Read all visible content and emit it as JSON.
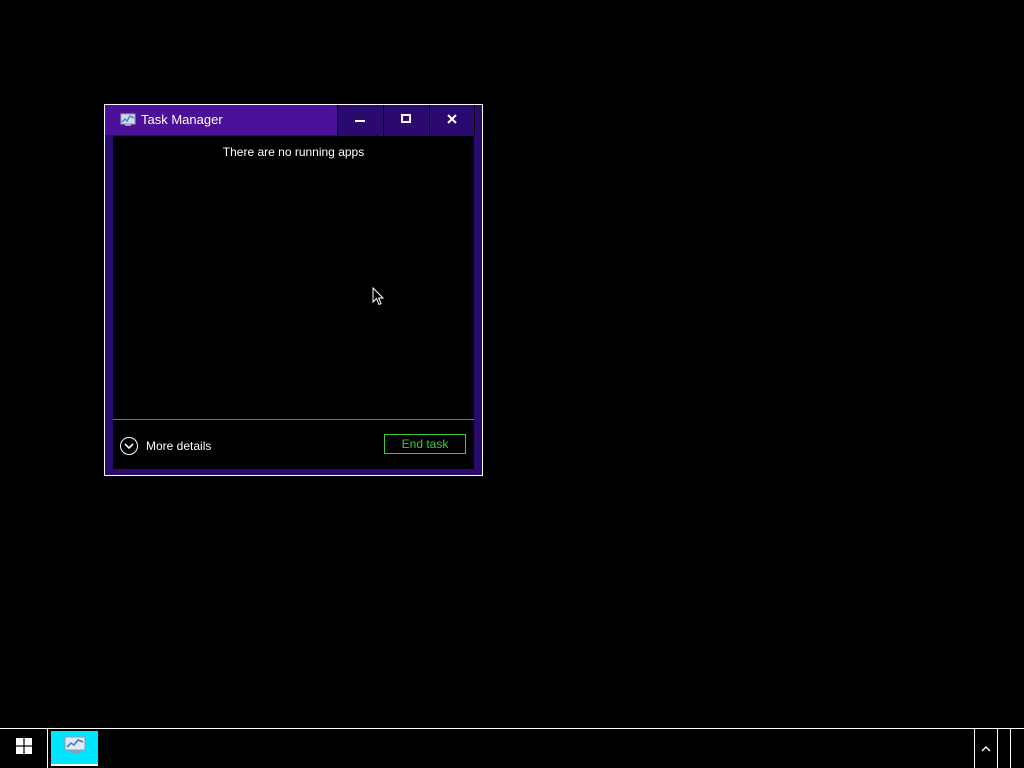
{
  "window": {
    "title": "Task Manager",
    "app_icon": "task-manager-icon",
    "controls": {
      "minimize_icon": "minimize-icon",
      "maximize_icon": "maximize-icon",
      "close_icon": "close-icon"
    }
  },
  "content": {
    "empty_message": "There are no running apps"
  },
  "footer": {
    "more_details_label": "More details",
    "more_details_icon": "chevron-down-icon",
    "end_task_label": "End task"
  },
  "taskbar": {
    "start_icon": "windows-logo-icon",
    "pinned_app_icon": "task-manager-icon",
    "tray_icon": "chevron-up-icon"
  },
  "colors": {
    "titlebar": "#2a0a6e",
    "title_active": "#4b0f9a",
    "accent_green": "#3ec83e",
    "taskbar_app": "#00e5ff",
    "background": "#000000",
    "text": "#ffffff"
  }
}
